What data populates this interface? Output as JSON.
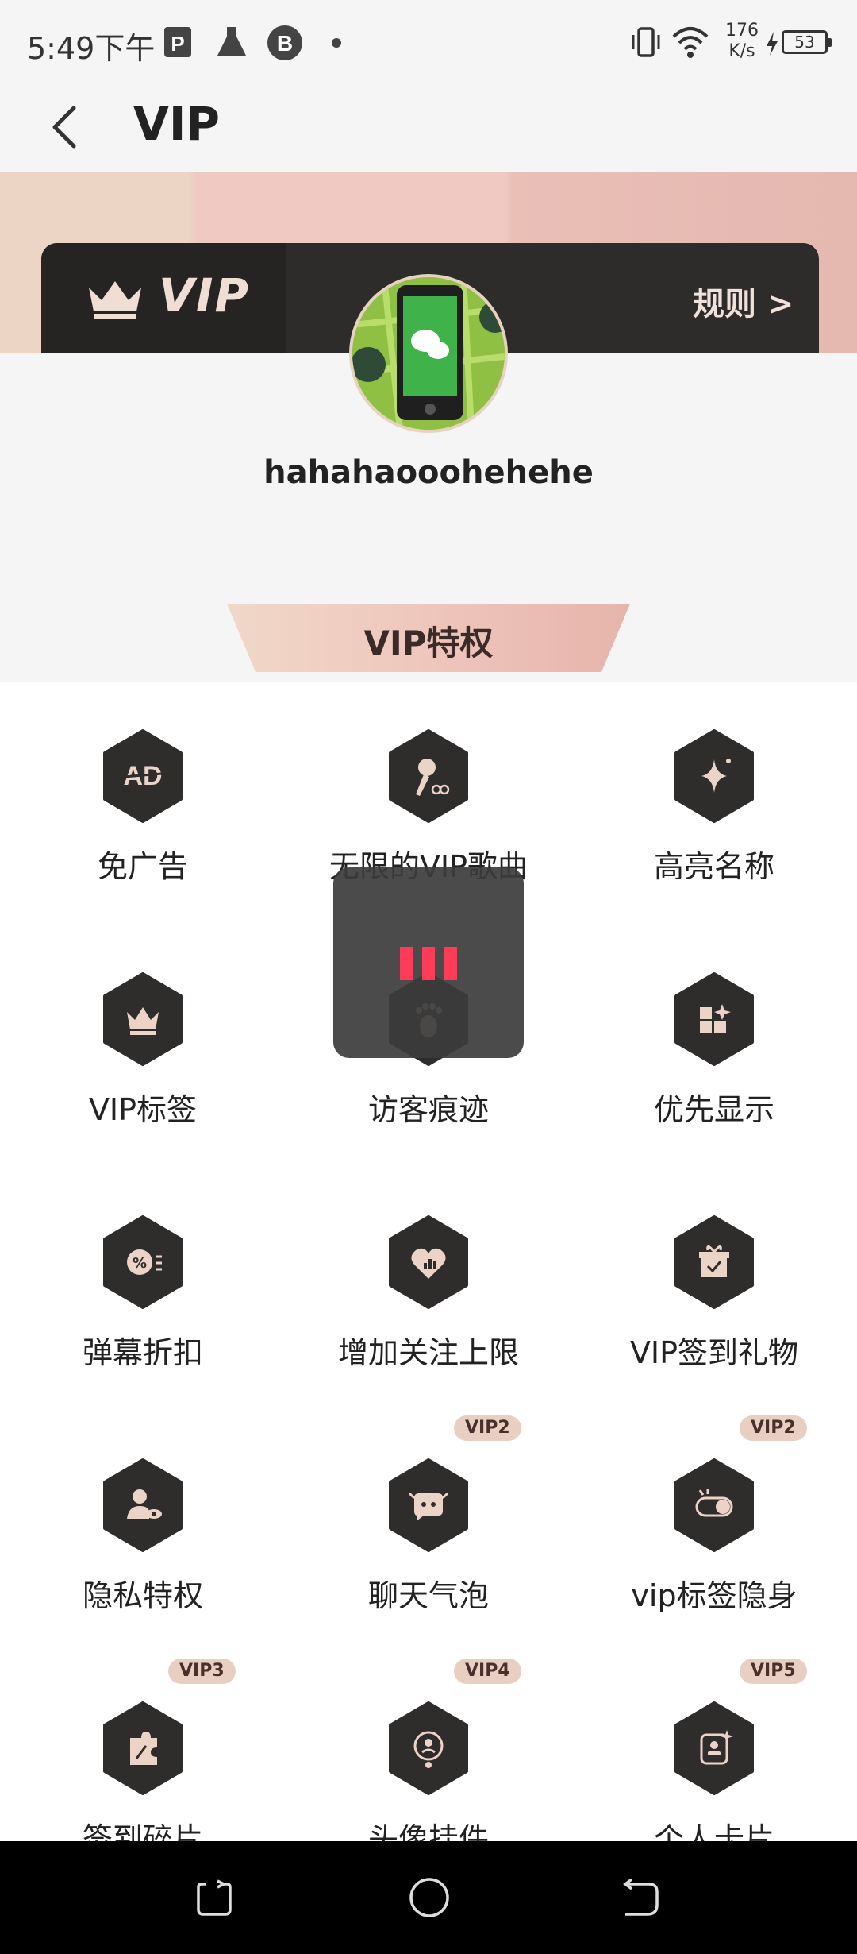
{
  "status_bar": {
    "time": "5:49下午",
    "net_speed_value": "176",
    "net_speed_unit": "K/s",
    "battery": "53",
    "icons": [
      "app-p-icon",
      "flask-icon",
      "bilibili-icon",
      "dot-icon",
      "vibrate-icon",
      "wifi-icon",
      "charging-icon",
      "battery-icon"
    ]
  },
  "header": {
    "title": "VIP"
  },
  "banner": {
    "logo_text": "VIP",
    "rules_label": "规则 >"
  },
  "user": {
    "username": "hahahaooohehehe"
  },
  "section": {
    "title": "VIP特权"
  },
  "privileges": [
    {
      "label": "免广告",
      "icon": "ad-free-icon",
      "badge": ""
    },
    {
      "label": "无限的VIP歌曲",
      "icon": "microphone-icon",
      "badge": ""
    },
    {
      "label": "高亮名称",
      "icon": "sparkle-icon",
      "badge": ""
    },
    {
      "label": "VIP标签",
      "icon": "crown-icon",
      "badge": ""
    },
    {
      "label": "访客痕迹",
      "icon": "footprint-icon",
      "badge": ""
    },
    {
      "label": "优先显示",
      "icon": "priority-grid-icon",
      "badge": ""
    },
    {
      "label": "弹幕折扣",
      "icon": "discount-icon",
      "badge": ""
    },
    {
      "label": "增加关注上限",
      "icon": "heart-chart-icon",
      "badge": ""
    },
    {
      "label": "VIP签到礼物",
      "icon": "gift-icon",
      "badge": ""
    },
    {
      "label": "隐私特权",
      "icon": "privacy-user-icon",
      "badge": ""
    },
    {
      "label": "聊天气泡",
      "icon": "chat-bubble-icon",
      "badge": "VIP2"
    },
    {
      "label": "vip标签隐身",
      "icon": "toggle-icon",
      "badge": "VIP2"
    },
    {
      "label": "签到碎片",
      "icon": "puzzle-icon",
      "badge": "VIP3"
    },
    {
      "label": "头像挂件",
      "icon": "avatar-frame-icon",
      "badge": "VIP4"
    },
    {
      "label": "个人卡片",
      "icon": "profile-card-icon",
      "badge": "VIP5"
    }
  ],
  "colors": {
    "accent": "#ff3b5a",
    "card_dark": "#2e2b2b",
    "badge_bg": "#e8cfc2",
    "hex_dark": "#2f2c2c",
    "icon_tint": "#ecd3c8"
  }
}
